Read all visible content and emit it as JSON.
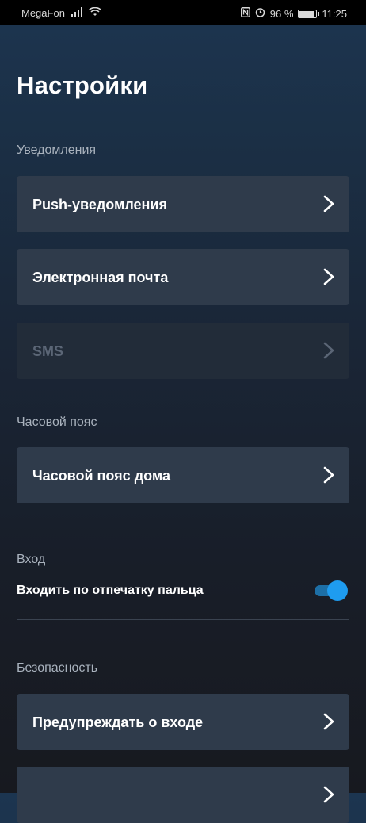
{
  "status_bar": {
    "carrier": "MegaFon",
    "battery_percent": "96 %",
    "battery_level": 0.96,
    "time": "11:25",
    "icons": [
      "signal-icon",
      "wifi-icon",
      "nfc-icon",
      "alarm-icon",
      "battery-icon"
    ]
  },
  "page": {
    "title": "Настройки"
  },
  "notifications": {
    "label": "Уведомления",
    "items": [
      {
        "label": "Push-уведомления",
        "enabled": true
      },
      {
        "label": "Электронная почта",
        "enabled": true
      },
      {
        "label": "SMS",
        "enabled": false
      }
    ]
  },
  "timezone": {
    "label": "Часовой пояс",
    "items": [
      {
        "label": "Часовой пояс дома"
      }
    ]
  },
  "login": {
    "label": "Вход",
    "fingerprint_label": "Входить по отпечатку пальца",
    "fingerprint_enabled": true
  },
  "security": {
    "label": "Безопасность",
    "items": [
      {
        "label": "Предупреждать о входе"
      }
    ]
  },
  "colors": {
    "accent": "#1e9cf0",
    "card": "#2f3b4b",
    "card_disabled": "#222c39",
    "text_muted": "#a9b2bd"
  }
}
